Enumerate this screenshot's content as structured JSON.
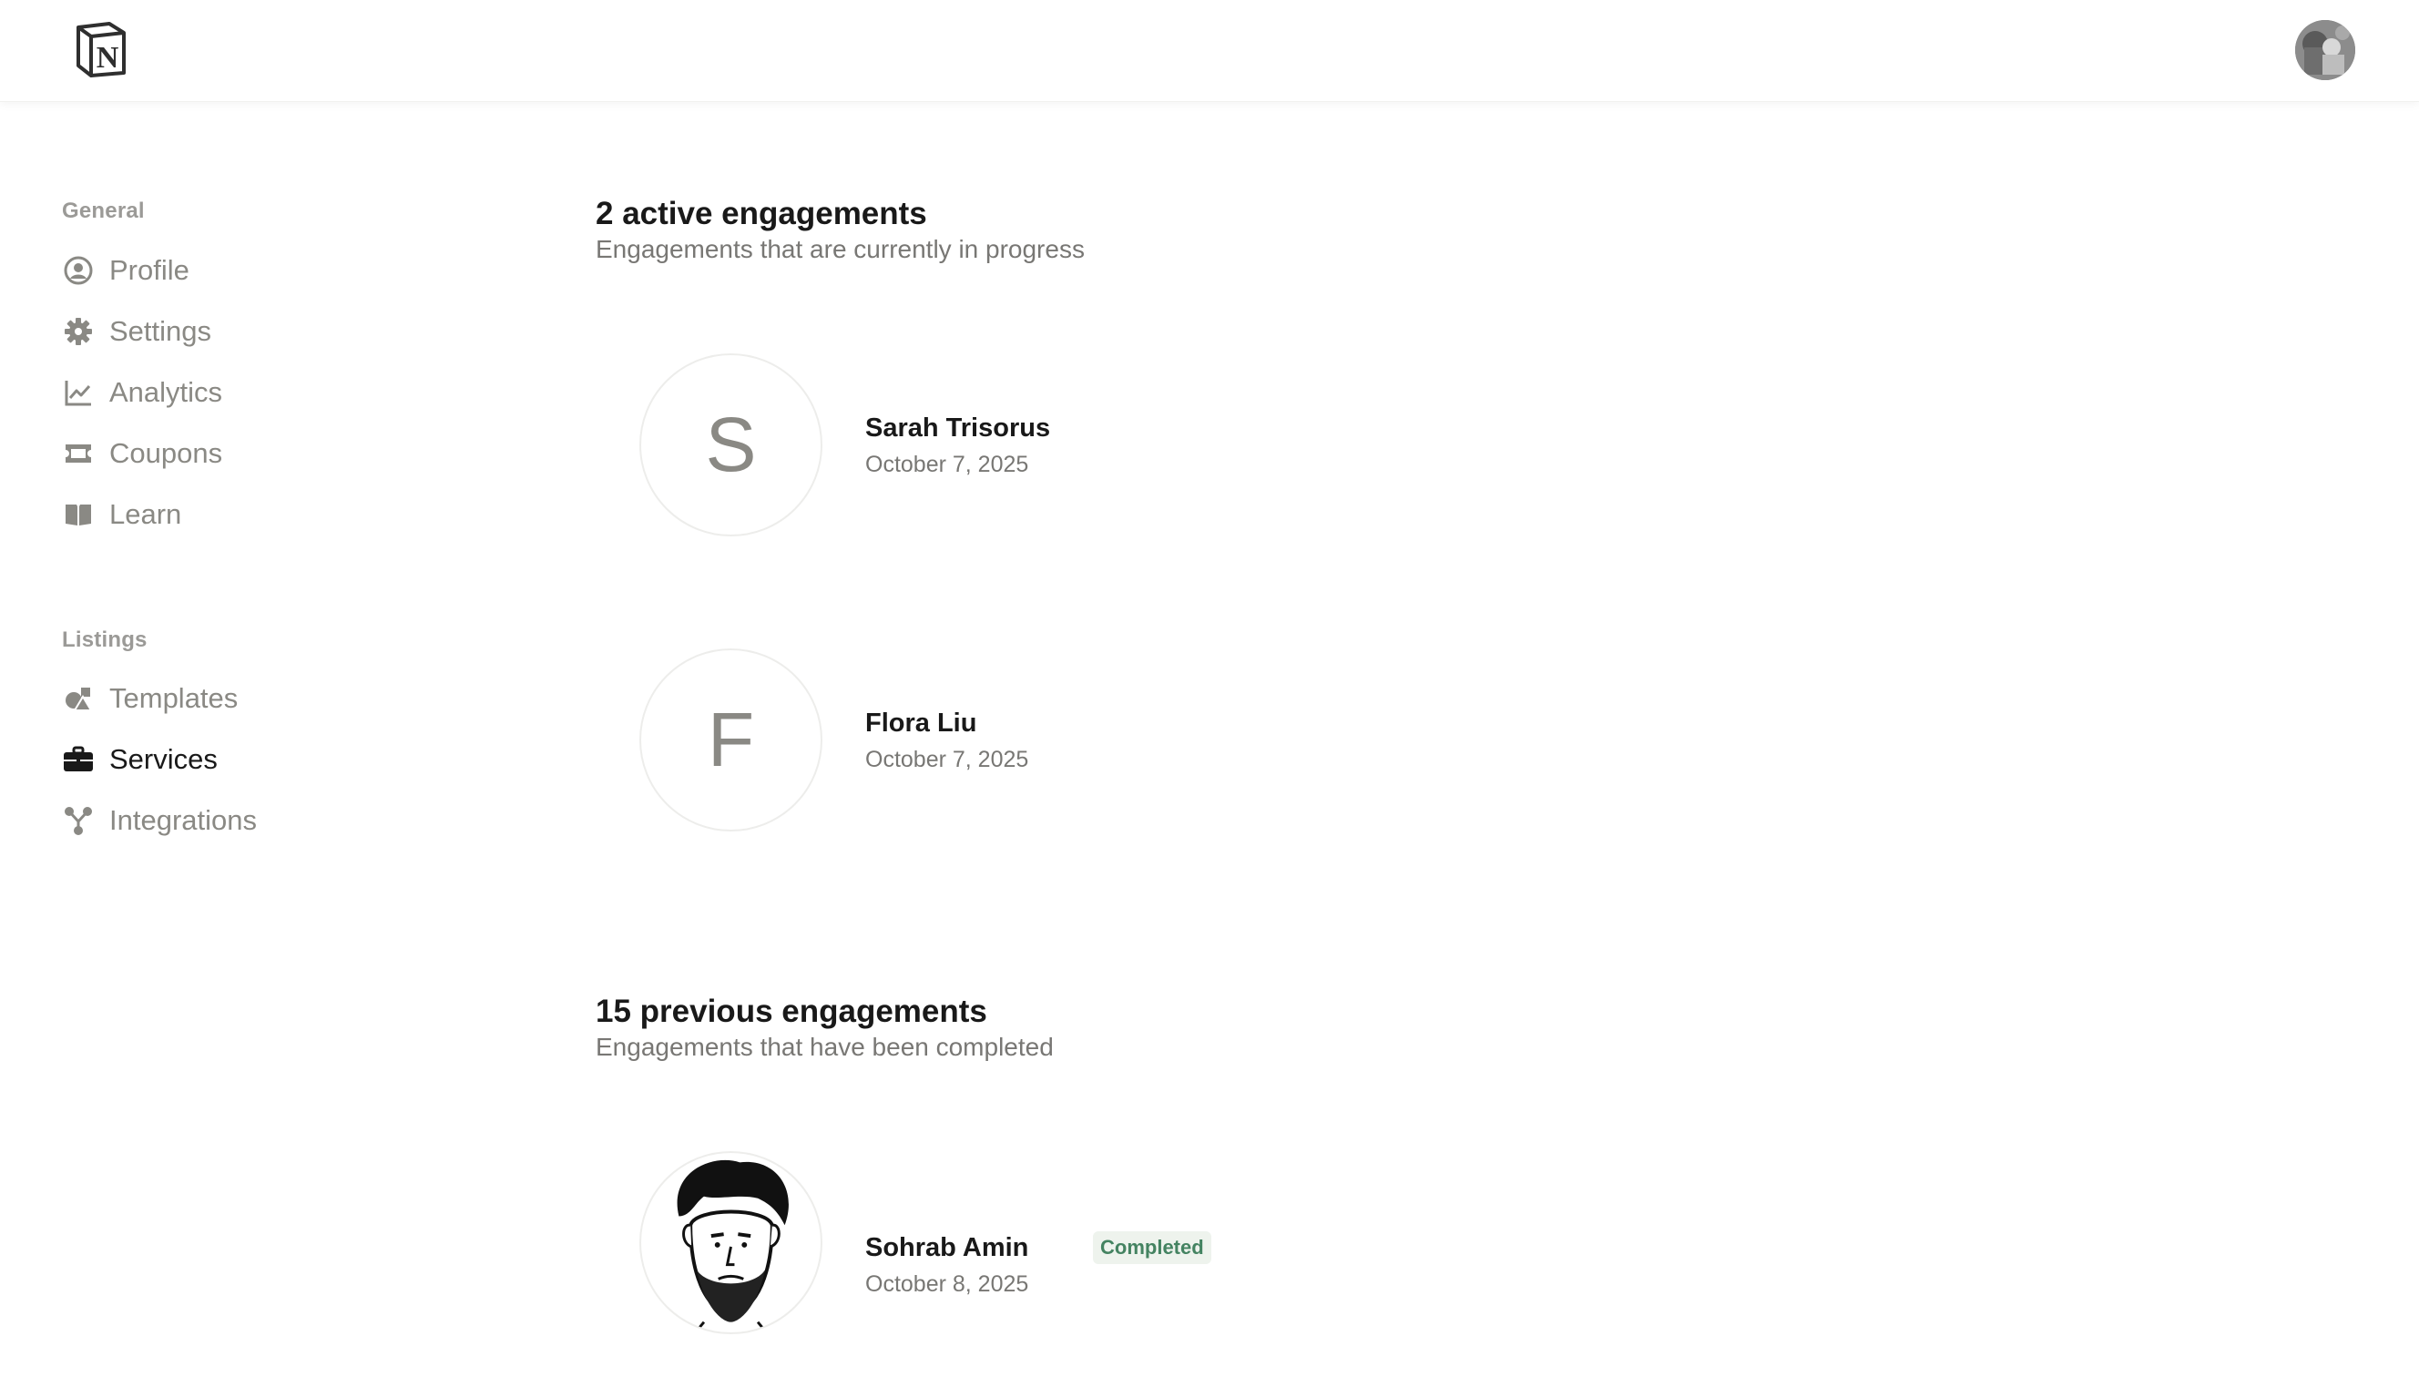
{
  "header": {
    "logo_letter": "N",
    "logo_icon": "notion-logo-icon",
    "user_avatar_icon": "user-avatar-photo"
  },
  "sidebar": {
    "sections": [
      {
        "label": "General",
        "items": [
          {
            "label": "Profile",
            "icon": "user-circle-icon",
            "active": false
          },
          {
            "label": "Settings",
            "icon": "gear-icon",
            "active": false
          },
          {
            "label": "Analytics",
            "icon": "chart-line-icon",
            "active": false
          },
          {
            "label": "Coupons",
            "icon": "ticket-icon",
            "active": false
          },
          {
            "label": "Learn",
            "icon": "book-open-icon",
            "active": false
          }
        ]
      },
      {
        "label": "Listings",
        "items": [
          {
            "label": "Templates",
            "icon": "shapes-icon",
            "active": false
          },
          {
            "label": "Services",
            "icon": "briefcase-icon",
            "active": true
          },
          {
            "label": "Integrations",
            "icon": "nodes-icon",
            "active": false
          }
        ]
      }
    ]
  },
  "main": {
    "active": {
      "title": "2 active engagements",
      "subtitle": "Engagements that are currently in progress",
      "items": [
        {
          "initial": "S",
          "name": "Sarah Trisorus",
          "date": "October 7, 2025"
        },
        {
          "initial": "F",
          "name": "Flora Liu",
          "date": "October 7, 2025"
        }
      ]
    },
    "previous": {
      "title": "15 previous engagements",
      "subtitle": "Engagements that have been completed",
      "items": [
        {
          "avatar": "illustrated-portrait",
          "name": "Sohrab Amin",
          "badge": "Completed",
          "date": "October 8, 2025"
        }
      ]
    }
  },
  "colors": {
    "accent_text": "#191919",
    "muted_text": "#8a8984",
    "badge_green": "#448361",
    "badge_bg": "#eef3ed"
  }
}
